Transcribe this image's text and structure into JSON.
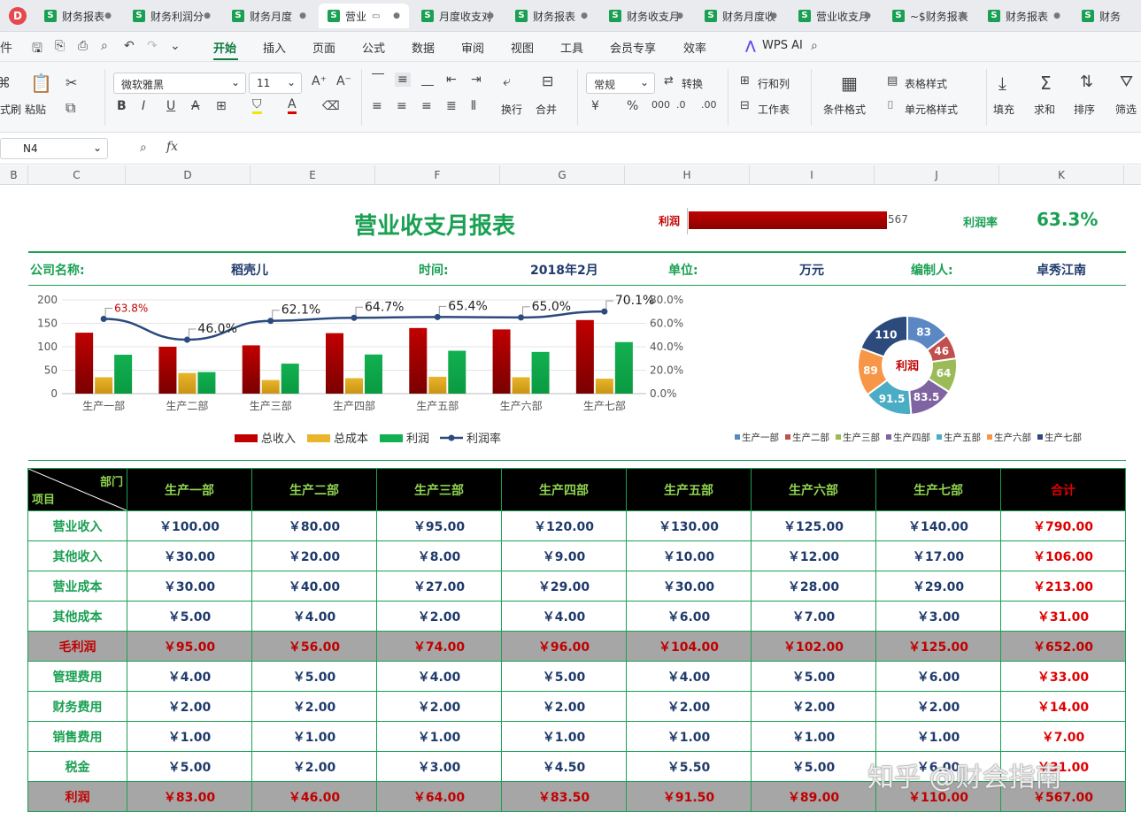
{
  "tabs": {
    "items": [
      {
        "label": "财务报表",
        "active": false
      },
      {
        "label": "财务利润分",
        "active": false
      },
      {
        "label": "财务月度",
        "active": false
      },
      {
        "label": "营业",
        "active": true
      },
      {
        "label": "月度收支对",
        "active": false
      },
      {
        "label": "财务报表",
        "active": false
      },
      {
        "label": "财务收支月",
        "active": false
      },
      {
        "label": "财务月度收",
        "active": false
      },
      {
        "label": "营业收支月",
        "active": false
      },
      {
        "label": "~$财务报表",
        "active": false
      },
      {
        "label": "财务报表",
        "active": false
      },
      {
        "label": "财务",
        "active": false
      }
    ]
  },
  "menu": {
    "file_partial": "件",
    "items": [
      "开始",
      "插入",
      "页面",
      "公式",
      "数据",
      "审阅",
      "视图",
      "工具",
      "会员专享",
      "效率"
    ],
    "wps_ai": "WPS AI"
  },
  "ribbon": {
    "format_painter": "式刷",
    "paste": "粘贴",
    "font_name": "微软雅黑",
    "font_size": "11",
    "wrap": "换行",
    "merge": "合并",
    "number_format": "常规",
    "convert": "转换",
    "rows_cols": "行和列",
    "worksheet": "工作表",
    "cond_format": "条件格式",
    "table_style": "表格样式",
    "cell_style": "单元格样式",
    "fill": "填充",
    "sum": "求和",
    "sort": "排序",
    "filter": "筛选"
  },
  "formula_bar": {
    "cell_ref": "N4",
    "fx": "fx"
  },
  "columns": [
    "B",
    "C",
    "D",
    "E",
    "F",
    "G",
    "H",
    "I",
    "J",
    "K"
  ],
  "report": {
    "title": "营业收支月报表",
    "profit_label": "利润",
    "profit_value": "567",
    "profit_rate_label": "利润率",
    "profit_rate": "63.3%",
    "company_label": "公司名称:",
    "company": "稻壳儿",
    "time_label": "时间:",
    "time": "2018年2月",
    "unit_label": "单位:",
    "unit": "万元",
    "editor_label": "编制人:",
    "editor": "卓秀江南"
  },
  "chart_data": [
    {
      "type": "bar",
      "categories": [
        "生产一部",
        "生产二部",
        "生产三部",
        "生产四部",
        "生产五部",
        "生产六部",
        "生产七部"
      ],
      "series": [
        {
          "name": "总收入",
          "type": "bar",
          "axis": "left",
          "values": [
            130,
            100,
            103,
            129,
            140,
            137,
            157
          ]
        },
        {
          "name": "总成本",
          "type": "bar",
          "axis": "left",
          "values": [
            35,
            44,
            29,
            33,
            36,
            35,
            32
          ]
        },
        {
          "name": "利润",
          "type": "bar",
          "axis": "left",
          "values": [
            83,
            46,
            64,
            83.5,
            91.5,
            89,
            110
          ]
        },
        {
          "name": "利润率",
          "type": "line",
          "axis": "right",
          "values": [
            63.8,
            46.0,
            62.1,
            64.7,
            65.4,
            65.0,
            70.1
          ]
        }
      ],
      "data_labels": [
        "63.8%",
        "46.0%",
        "62.1%",
        "64.7%",
        "65.4%",
        "65.0%",
        "70.1%"
      ],
      "ylim": [
        0,
        200
      ],
      "yticks": [
        "0",
        "50",
        "100",
        "150",
        "200"
      ],
      "y2lim": [
        0,
        80
      ],
      "y2ticks": [
        "0.0%",
        "20.0%",
        "40.0%",
        "60.0%",
        "80.0%"
      ],
      "legend": "bottom",
      "colors": {
        "总收入": "#c00000",
        "总成本": "#e8b52c",
        "利润": "#12b050",
        "利润率": "#2b4a7e"
      }
    },
    {
      "type": "pie",
      "center_label": "利润",
      "categories": [
        "生产一部",
        "生产二部",
        "生产三部",
        "生产四部",
        "生产五部",
        "生产六部",
        "生产七部"
      ],
      "values": [
        83,
        46,
        64,
        83.5,
        91.5,
        89,
        110
      ],
      "labels": [
        "83",
        "46",
        "64",
        "83.5",
        "91.5",
        "89",
        "110"
      ],
      "colors": [
        "#5b88c4",
        "#c0504d",
        "#9bbb59",
        "#8064a2",
        "#4bacc6",
        "#f79646",
        "#2c4a7c"
      ],
      "legend": "bottom"
    }
  ],
  "table": {
    "corner_dept": "部门",
    "corner_item": "项目",
    "headers": [
      "生产一部",
      "生产二部",
      "生产三部",
      "生产四部",
      "生产五部",
      "生产六部",
      "生产七部",
      "合计"
    ],
    "rows": [
      {
        "label": "营业收入",
        "gray": false,
        "values": [
          "￥100.00",
          "￥80.00",
          "￥95.00",
          "￥120.00",
          "￥130.00",
          "￥125.00",
          "￥140.00",
          "￥790.00"
        ]
      },
      {
        "label": "其他收入",
        "gray": false,
        "values": [
          "￥30.00",
          "￥20.00",
          "￥8.00",
          "￥9.00",
          "￥10.00",
          "￥12.00",
          "￥17.00",
          "￥106.00"
        ]
      },
      {
        "label": "营业成本",
        "gray": false,
        "values": [
          "￥30.00",
          "￥40.00",
          "￥27.00",
          "￥29.00",
          "￥30.00",
          "￥28.00",
          "￥29.00",
          "￥213.00"
        ]
      },
      {
        "label": "其他成本",
        "gray": false,
        "values": [
          "￥5.00",
          "￥4.00",
          "￥2.00",
          "￥4.00",
          "￥6.00",
          "￥7.00",
          "￥3.00",
          "￥31.00"
        ]
      },
      {
        "label": "毛利润",
        "gray": true,
        "values": [
          "￥95.00",
          "￥56.00",
          "￥74.00",
          "￥96.00",
          "￥104.00",
          "￥102.00",
          "￥125.00",
          "￥652.00"
        ]
      },
      {
        "label": "管理费用",
        "gray": false,
        "values": [
          "￥4.00",
          "￥5.00",
          "￥4.00",
          "￥5.00",
          "￥4.00",
          "￥5.00",
          "￥6.00",
          "￥33.00"
        ]
      },
      {
        "label": "财务费用",
        "gray": false,
        "values": [
          "￥2.00",
          "￥2.00",
          "￥2.00",
          "￥2.00",
          "￥2.00",
          "￥2.00",
          "￥2.00",
          "￥14.00"
        ]
      },
      {
        "label": "销售费用",
        "gray": false,
        "values": [
          "￥1.00",
          "￥1.00",
          "￥1.00",
          "￥1.00",
          "￥1.00",
          "￥1.00",
          "￥1.00",
          "￥7.00"
        ]
      },
      {
        "label": "税金",
        "gray": false,
        "values": [
          "￥5.00",
          "￥2.00",
          "￥3.00",
          "￥4.50",
          "￥5.50",
          "￥5.00",
          "￥6.00",
          "￥31.00"
        ]
      },
      {
        "label": "利润",
        "gray": true,
        "values": [
          "￥83.00",
          "￥46.00",
          "￥64.00",
          "￥83.50",
          "￥91.50",
          "￥89.00",
          "￥110.00",
          "￥567.00"
        ]
      }
    ]
  },
  "watermark": "知乎 @财会指南"
}
